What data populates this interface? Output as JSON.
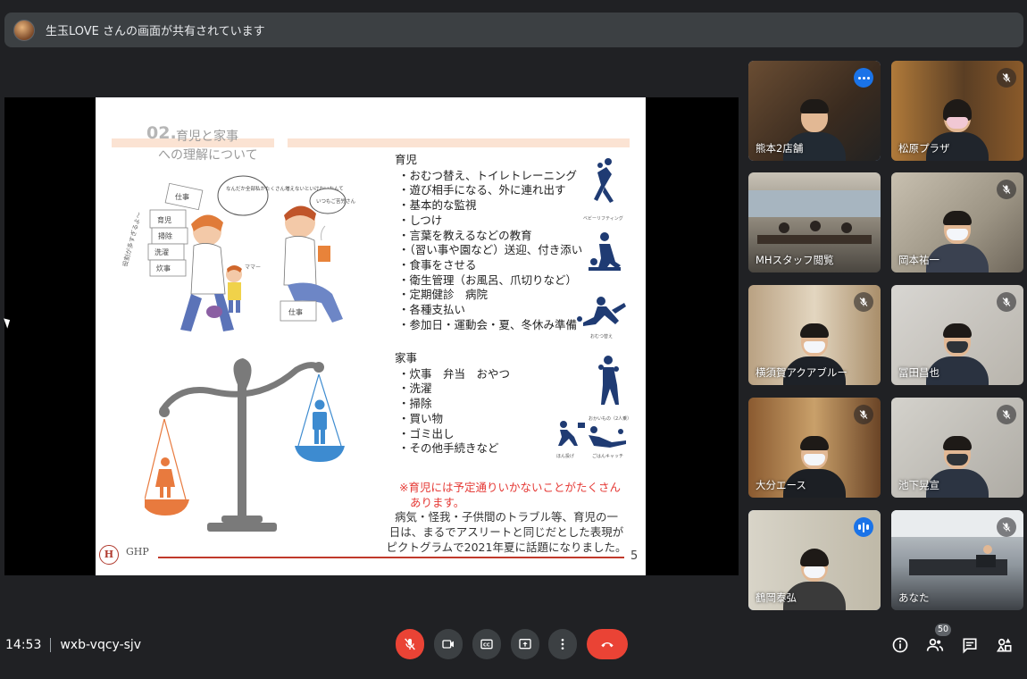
{
  "banner": {
    "text": "生玉LOVE さんの画面が共有されています"
  },
  "slide": {
    "title_number": "02.",
    "title_line1": "育児と家事",
    "title_line2": "への理解について",
    "childcare": {
      "heading": "育児",
      "items": [
        "・おむつ替え、トイレトレーニング",
        "・遊び相手になる、外に連れ出す",
        "・基本的な監視",
        "・しつけ",
        "・言葉を教えるなどの教育",
        "・（習い事や園など）送迎、付き添い",
        "・食事をさせる",
        "・衛生管理（お風呂、爪切りなど）",
        "・定期健診　病院",
        "・各種支払い",
        "・参加日・運動会・夏、冬休み準備"
      ]
    },
    "housework": {
      "heading": "家事",
      "items": [
        "・炊事　弁当　おやつ",
        "・洗濯",
        "・掃除",
        "・買い物",
        "・ゴミ出し",
        "・その他手続きなど"
      ]
    },
    "pictogram_captions": [
      "ベビーリフティング",
      "おむつ替え",
      "おかいもの（2人乗）",
      "ほん投げ",
      "ごはんキャッチ"
    ],
    "illustration_bubbles": [
      "なんだか全部私がたくさん増えないといけないなんて",
      "いつもご苦労さん"
    ],
    "illustration_signs": [
      "仕事",
      "育児",
      "掃除",
      "洗濯",
      "炊事",
      "仕事"
    ],
    "illustration_side_text": "役割が多すぎるよ～",
    "illustration_child_text": "ママー",
    "note_red_line1": "※育児には予定通りいかないことがたくさん",
    "note_red_line2": "あります。",
    "note_body_line1": "病気・怪我・子供間のトラブル等、育児の一",
    "note_body_line2": "日は、まるでアスリートと同じだとした表現が",
    "note_body_line3": "ピクトグラムで2021年夏に話題になりました。",
    "logo_letter": "H",
    "logo_text": "GHP",
    "page_number": "5"
  },
  "participants": [
    {
      "name": "熊本2店舗",
      "state": "more-options"
    },
    {
      "name": "松原プラザ",
      "state": "muted"
    },
    {
      "name": "MHスタッフ閲覧",
      "state": "none"
    },
    {
      "name": "岡本祐一",
      "state": "muted"
    },
    {
      "name": "横須賀アクアブルー",
      "state": "muted"
    },
    {
      "name": "冨田昌也",
      "state": "muted"
    },
    {
      "name": "大分エース",
      "state": "muted"
    },
    {
      "name": "池下晃宣",
      "state": "muted"
    },
    {
      "name": "鶴岡泰弘",
      "state": "speaking"
    },
    {
      "name": "あなた",
      "state": "muted"
    }
  ],
  "meeting": {
    "time": "14:53",
    "code": "wxb-vqcy-sjv"
  },
  "participant_count": "50",
  "icons": [
    "mic-off-icon",
    "camera-icon",
    "captions-icon",
    "present-icon",
    "more-vert-icon",
    "hangup-icon",
    "info-icon",
    "people-icon",
    "chat-icon",
    "activities-icon"
  ],
  "colors": {
    "background": "#202124",
    "control": "#3c4043",
    "danger": "#ea4335",
    "accent": "#1a73e8",
    "active_outline": "#8ab4f8",
    "note_red": "#e53935"
  }
}
